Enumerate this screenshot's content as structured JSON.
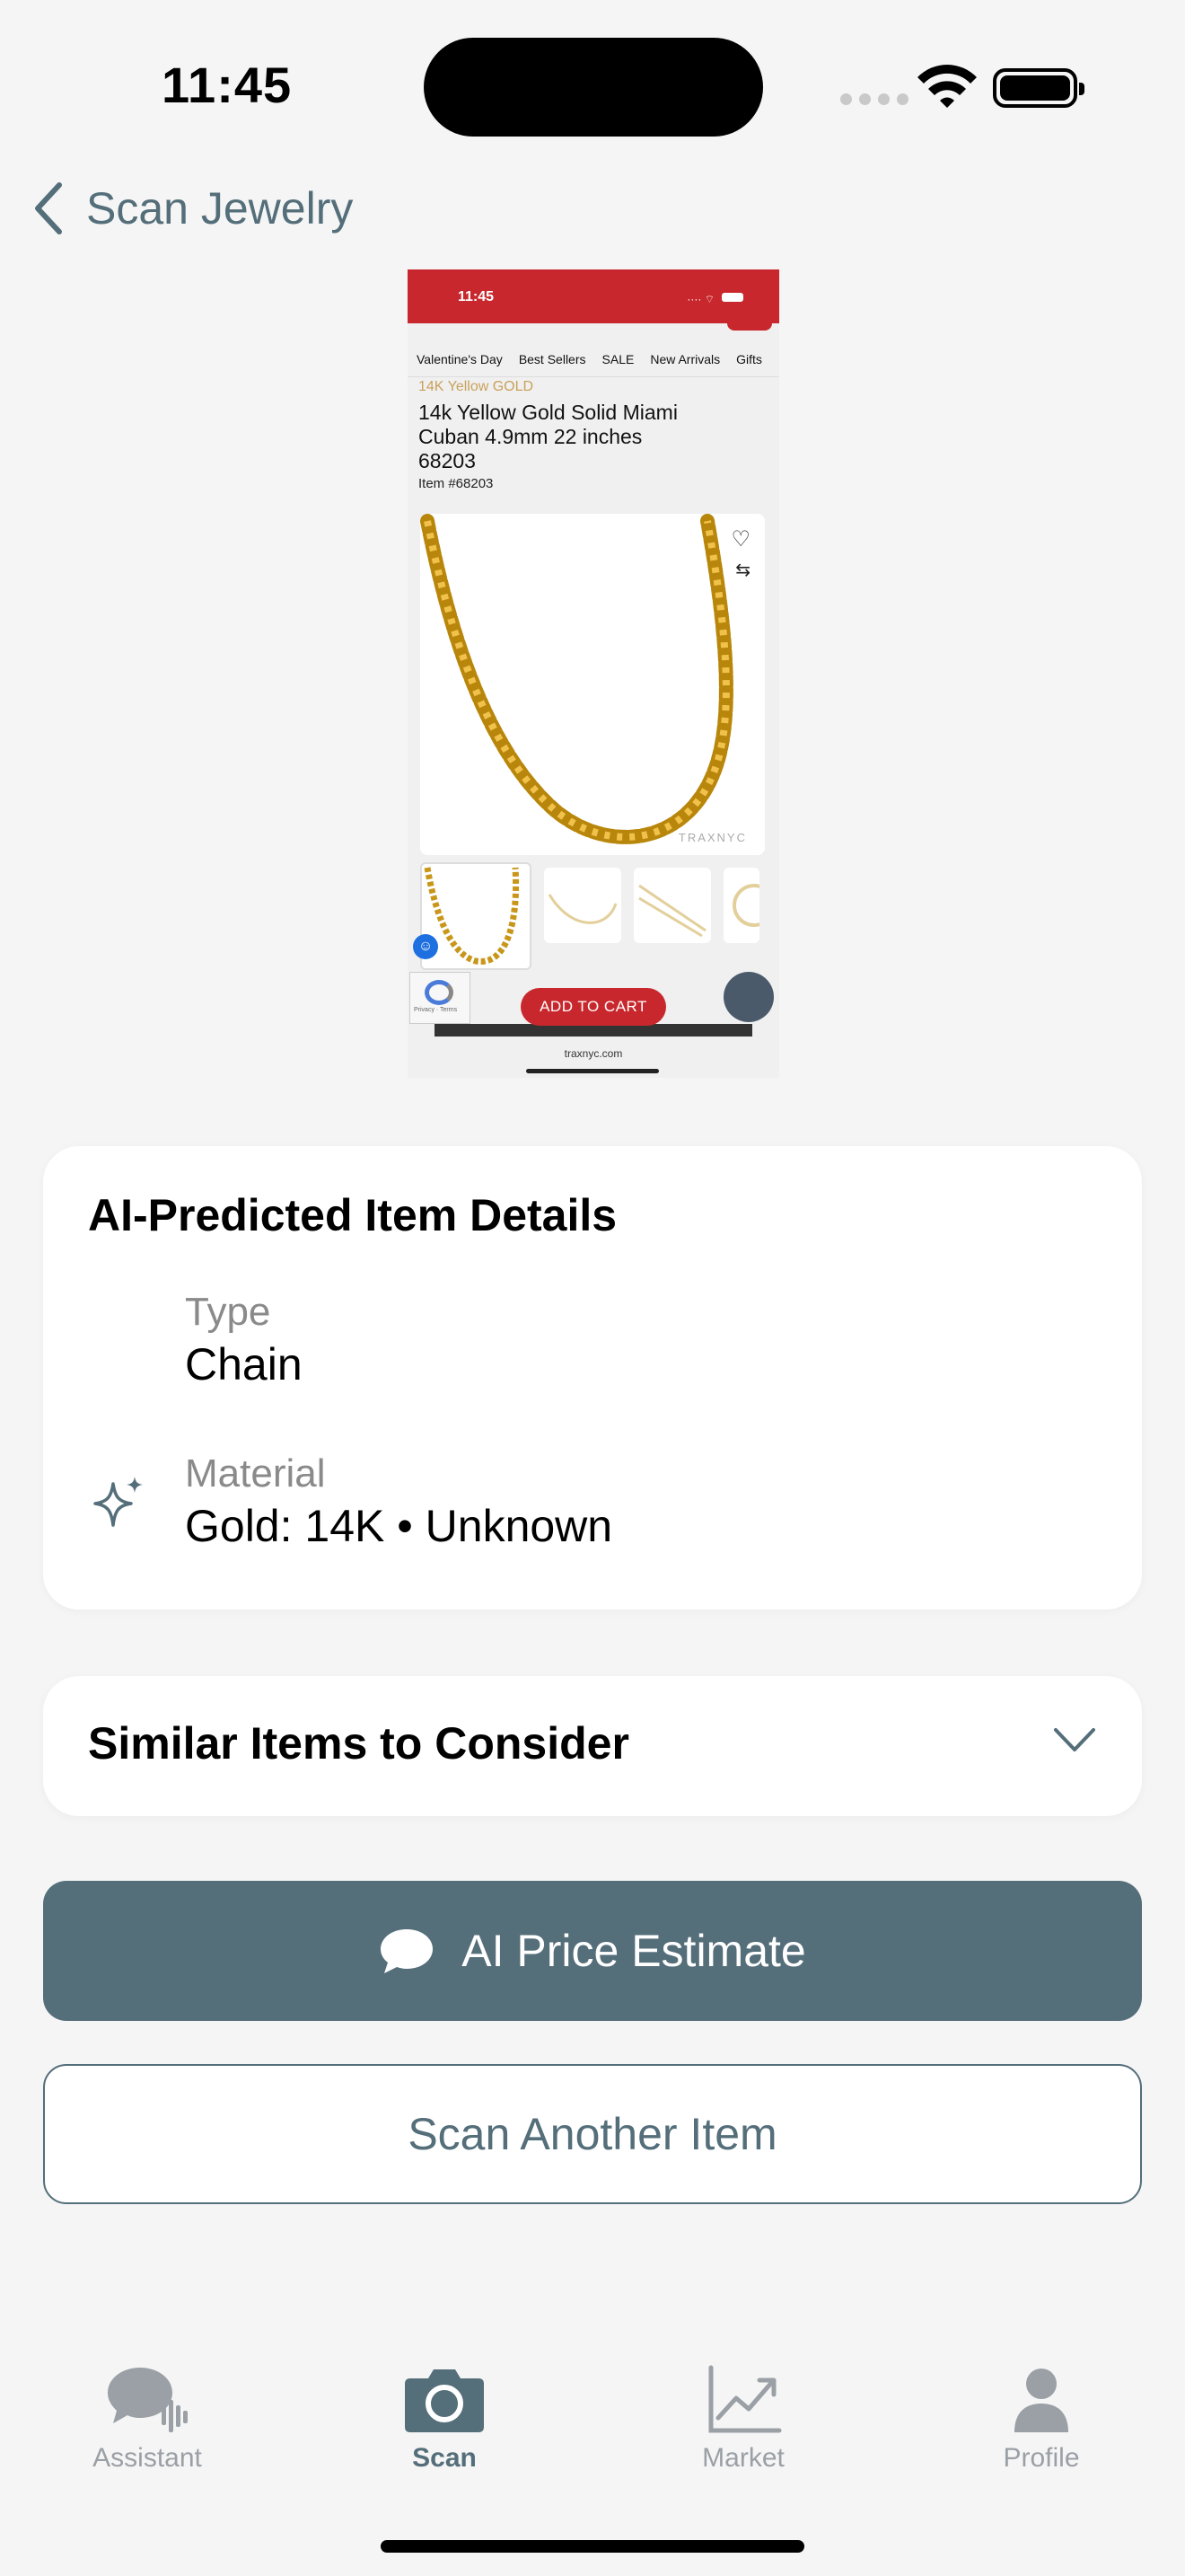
{
  "status_bar": {
    "time": "11:45"
  },
  "nav": {
    "back_label": "Scan Jewelry"
  },
  "scanned_screenshot": {
    "status_time": "11:45",
    "menu": [
      "Valentine's Day",
      "Best Sellers",
      "SALE",
      "New Arrivals",
      "Gifts"
    ],
    "category": "14K Yellow GOLD",
    "title": "14k Yellow Gold Solid Miami Cuban 4.9mm 22 inches 68203",
    "item_number": "Item #68203",
    "watermark": "TRAXNYC",
    "add_to_cart": "ADD TO CART",
    "recaptcha_text": "Privacy · Terms",
    "url": "traxnyc.com"
  },
  "details_card": {
    "title": "AI-Predicted Item Details",
    "type_label": "Type",
    "type_value": "Chain",
    "material_label": "Material",
    "material_value": "Gold: 14K • Unknown"
  },
  "similar_card": {
    "title": "Similar Items to Consider"
  },
  "buttons": {
    "price_estimate": "AI Price Estimate",
    "scan_another": "Scan Another Item"
  },
  "tab_bar": {
    "tabs": [
      {
        "label": "Assistant",
        "icon": "assistant-chat-icon",
        "active": false
      },
      {
        "label": "Scan",
        "icon": "camera-icon",
        "active": true
      },
      {
        "label": "Market",
        "icon": "chart-icon",
        "active": false
      },
      {
        "label": "Profile",
        "icon": "person-icon",
        "active": false
      }
    ]
  },
  "colors": {
    "accent": "#546e7a",
    "background": "#f5f5f5",
    "brand_red": "#c8282d"
  }
}
